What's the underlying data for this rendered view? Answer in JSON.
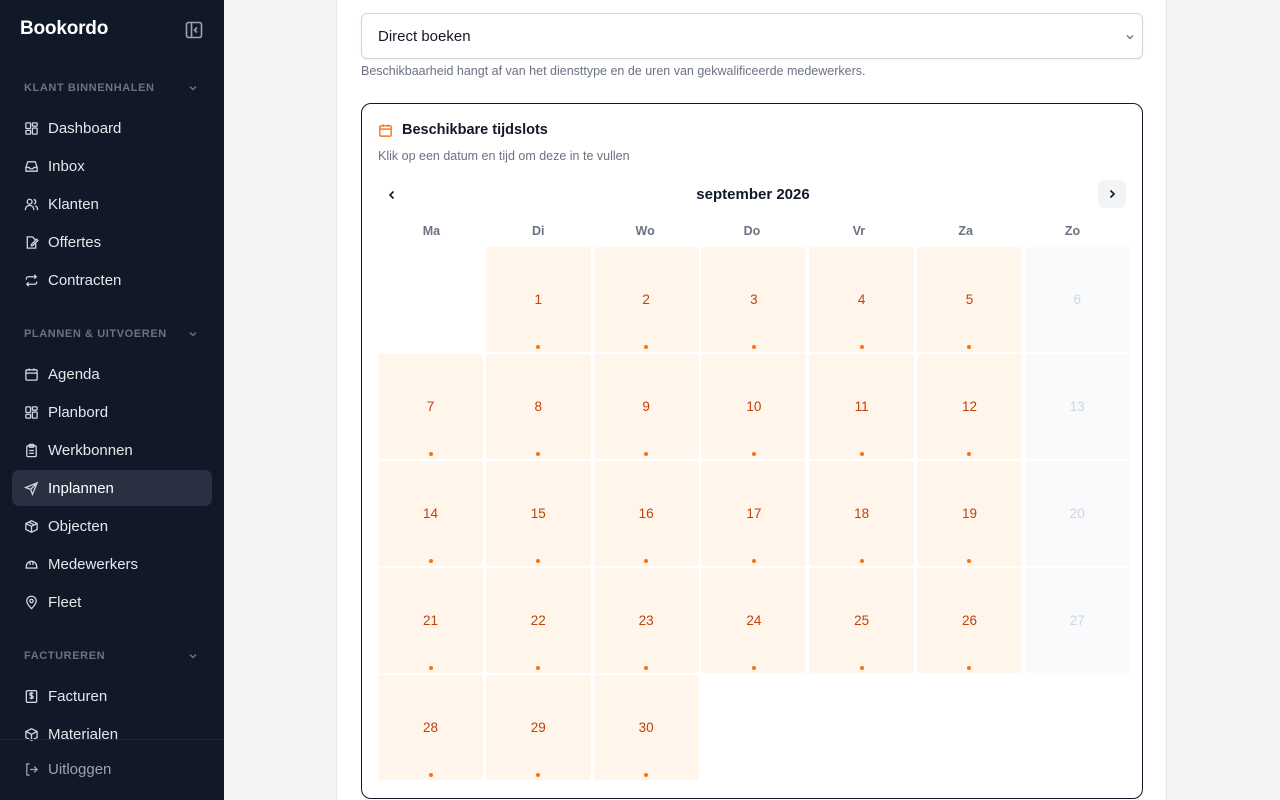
{
  "app": {
    "brand": "Bookordo",
    "logout_label": "Uitloggen"
  },
  "sidebar": {
    "sections": [
      {
        "title": "KLANT BINNENHALEN",
        "items": [
          {
            "label": "Dashboard",
            "icon": "dashboard-icon"
          },
          {
            "label": "Inbox",
            "icon": "inbox-icon"
          },
          {
            "label": "Klanten",
            "icon": "users-icon"
          },
          {
            "label": "Offertes",
            "icon": "document-edit-icon"
          },
          {
            "label": "Contracten",
            "icon": "repeat-icon"
          }
        ]
      },
      {
        "title": "PLANNEN & UITVOEREN",
        "items": [
          {
            "label": "Agenda",
            "icon": "calendar-icon"
          },
          {
            "label": "Planbord",
            "icon": "grid-icon"
          },
          {
            "label": "Werkbonnen",
            "icon": "clipboard-icon"
          },
          {
            "label": "Inplannen",
            "icon": "send-icon",
            "active": true
          },
          {
            "label": "Objecten",
            "icon": "box-icon"
          },
          {
            "label": "Medewerkers",
            "icon": "hard-hat-icon"
          },
          {
            "label": "Fleet",
            "icon": "map-pin-icon"
          }
        ]
      },
      {
        "title": "FACTUREREN",
        "items": [
          {
            "label": "Facturen",
            "icon": "invoice-icon"
          },
          {
            "label": "Materialen",
            "icon": "package-icon"
          }
        ]
      }
    ]
  },
  "form": {
    "booking_type_value": "Direct boeken",
    "helper_text": "Beschikbaarheid hangt af van het diensttype en de uren van gekwalificeerde medewerkers."
  },
  "slots": {
    "title": "Beschikbare tijdslots",
    "subtitle": "Klik op een datum en tijd om deze in te vullen",
    "month_label": "september 2026",
    "weekdays": [
      "Ma",
      "Di",
      "Wo",
      "Do",
      "Vr",
      "Za",
      "Zo"
    ],
    "leading_empty_days": 1,
    "days": [
      {
        "n": "1",
        "available": true
      },
      {
        "n": "2",
        "available": true
      },
      {
        "n": "3",
        "available": true
      },
      {
        "n": "4",
        "available": true
      },
      {
        "n": "5",
        "available": true
      },
      {
        "n": "6",
        "available": false
      },
      {
        "n": "7",
        "available": true
      },
      {
        "n": "8",
        "available": true
      },
      {
        "n": "9",
        "available": true
      },
      {
        "n": "10",
        "available": true
      },
      {
        "n": "11",
        "available": true
      },
      {
        "n": "12",
        "available": true
      },
      {
        "n": "13",
        "available": false
      },
      {
        "n": "14",
        "available": true
      },
      {
        "n": "15",
        "available": true
      },
      {
        "n": "16",
        "available": true
      },
      {
        "n": "17",
        "available": true
      },
      {
        "n": "18",
        "available": true
      },
      {
        "n": "19",
        "available": true
      },
      {
        "n": "20",
        "available": false
      },
      {
        "n": "21",
        "available": true
      },
      {
        "n": "22",
        "available": true
      },
      {
        "n": "23",
        "available": true
      },
      {
        "n": "24",
        "available": true
      },
      {
        "n": "25",
        "available": true
      },
      {
        "n": "26",
        "available": true
      },
      {
        "n": "27",
        "available": false
      },
      {
        "n": "28",
        "available": true
      },
      {
        "n": "29",
        "available": true
      },
      {
        "n": "30",
        "available": true
      }
    ]
  },
  "colors": {
    "sidebar_bg": "#111827",
    "active_item_bg": "#283041",
    "accent": "#f97316",
    "available_day_bg": "#fff5eb",
    "available_day_text": "#c2410c"
  }
}
